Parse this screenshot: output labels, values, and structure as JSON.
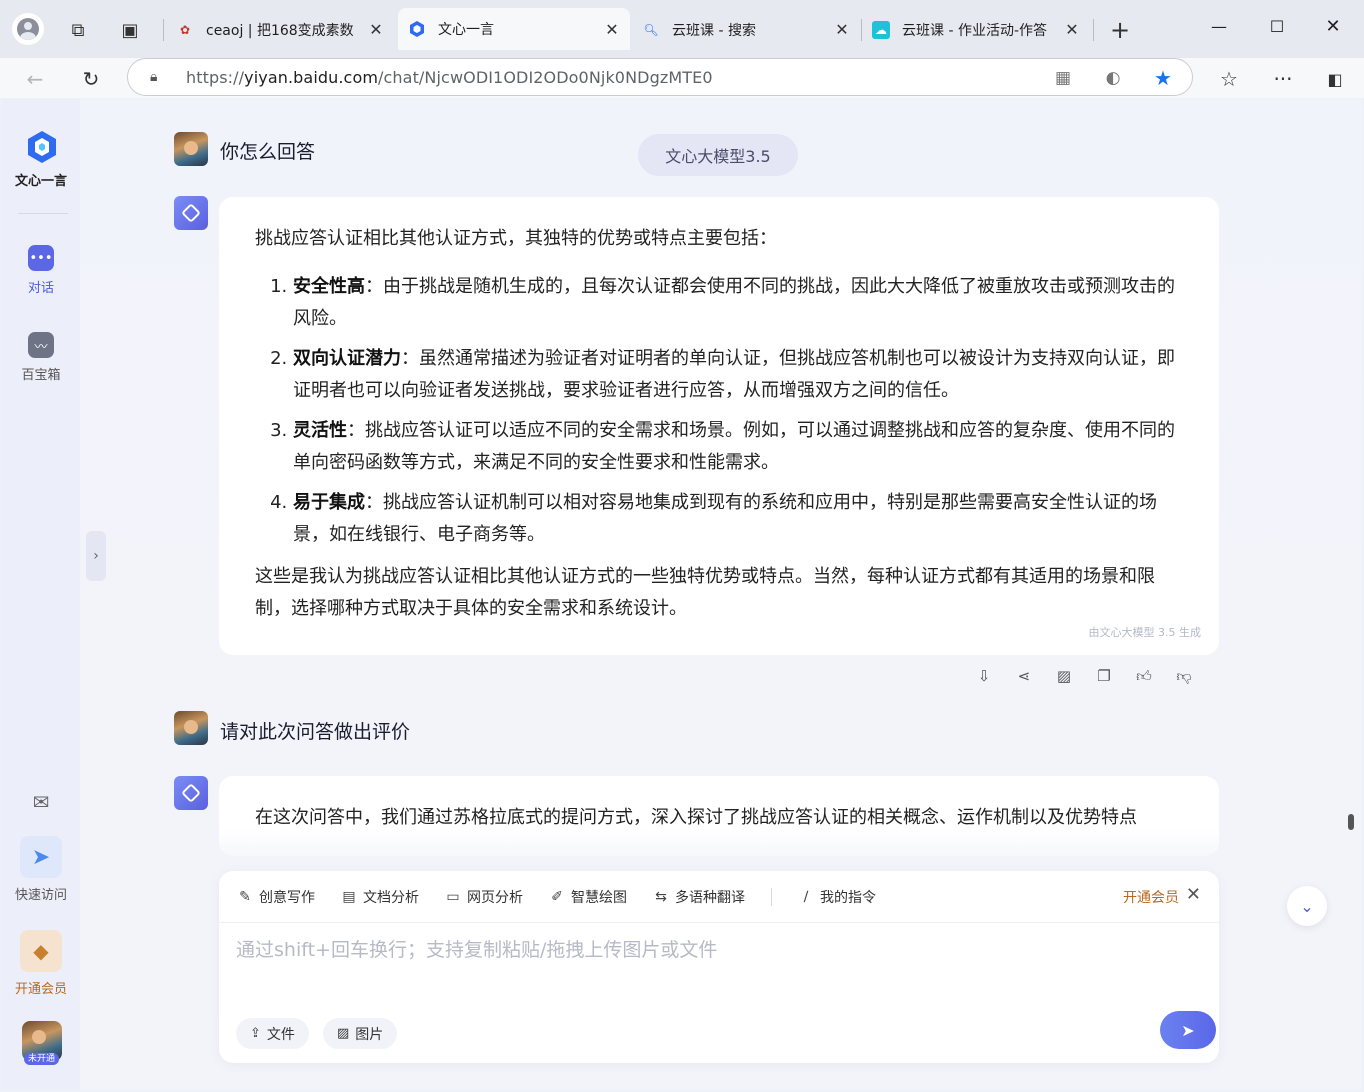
{
  "browser": {
    "tabs": [
      {
        "title": "ceaoj | 把168变成素数"
      },
      {
        "title": "文心一言"
      },
      {
        "title": "云班课 - 搜索"
      },
      {
        "title": "云班课 - 作业活动-作答"
      }
    ],
    "url_prefix": "https://",
    "url_domain": "yiyan.baidu.com",
    "url_path": "/chat/NjcwODI1ODI2ODo0Njk0NDgzMTE0"
  },
  "sidebar": {
    "logo_text": "文心一言",
    "items": [
      {
        "label": "对话"
      },
      {
        "label": "百宝箱"
      }
    ],
    "quick_access_label": "快速访问",
    "vip_label": "开通会员",
    "user_badge": "未开通"
  },
  "chat": {
    "model_pill": "文心大模型3.5",
    "q1": "你怎么回答",
    "answer": {
      "intro": "挑战应答认证相比其他认证方式，其独特的优势或特点主要包括：",
      "points": [
        {
          "title": "安全性高",
          "text": "：由于挑战是随机生成的，且每次认证都会使用不同的挑战，因此大大降低了被重放攻击或预测攻击的风险。"
        },
        {
          "title": "双向认证潜力",
          "text": "：虽然通常描述为验证者对证明者的单向认证，但挑战应答机制也可以被设计为支持双向认证，即证明者也可以向验证者发送挑战，要求验证者进行应答，从而增强双方之间的信任。"
        },
        {
          "title": "灵活性",
          "text": "：挑战应答认证可以适应不同的安全需求和场景。例如，可以通过调整挑战和应答的复杂度、使用不同的单向密码函数等方式，来满足不同的安全性要求和性能需求。"
        },
        {
          "title": "易于集成",
          "text": "：挑战应答认证机制可以相对容易地集成到现有的系统和应用中，特别是那些需要高安全性认证的场景，如在线银行、电子商务等。"
        }
      ],
      "conclusion": "这些是我认为挑战应答认证相比其他认证方式的一些独特优势或特点。当然，每种认证方式都有其适用的场景和限制，选择哪种方式取决于具体的安全需求和系统设计。",
      "gen_tag": "由文心大模型 3.5 生成"
    },
    "q2": "请对此次问答做出评价",
    "answer2_preview": "在这次问答中，我们通过苏格拉底式的提问方式，深入探讨了挑战应答认证的相关概念、运作机制以及优势特点"
  },
  "input": {
    "tools": [
      {
        "label": "创意写作",
        "icon": "pen-icon"
      },
      {
        "label": "文档分析",
        "icon": "doc-icon"
      },
      {
        "label": "网页分析",
        "icon": "web-icon"
      },
      {
        "label": "智慧绘图",
        "icon": "brush-icon"
      },
      {
        "label": "多语种翻译",
        "icon": "translate-icon"
      }
    ],
    "my_commands": "我的指令",
    "vip_link": "开通会员",
    "placeholder": "通过shift+回车换行；支持复制粘贴/拖拽上传图片或文件",
    "file_chip": "文件",
    "image_chip": "图片"
  },
  "colors": {
    "accent": "#4d5bd8",
    "vip": "#b8691f",
    "send": "#5a67e8"
  }
}
